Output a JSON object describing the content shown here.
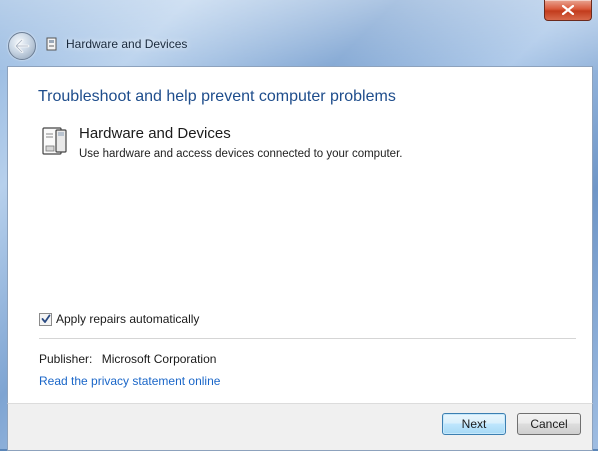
{
  "window": {
    "title": "Hardware and Devices",
    "close_symbol": "✕"
  },
  "main": {
    "heading": "Troubleshoot and help prevent computer problems",
    "item": {
      "icon": "hardware-device-icon",
      "title": "Hardware and Devices",
      "description": "Use hardware and access devices connected to your computer."
    },
    "apply_repairs": {
      "label": "Apply repairs automatically",
      "checked": true
    },
    "publisher": {
      "label": "Publisher:",
      "value": "Microsoft Corporation"
    },
    "privacy_link": "Read the privacy statement online"
  },
  "footer": {
    "next_label": "Next",
    "cancel_label": "Cancel"
  },
  "colors": {
    "heading": "#1e4d8c",
    "link": "#1a66c8",
    "close_button": "#c23b1c"
  }
}
